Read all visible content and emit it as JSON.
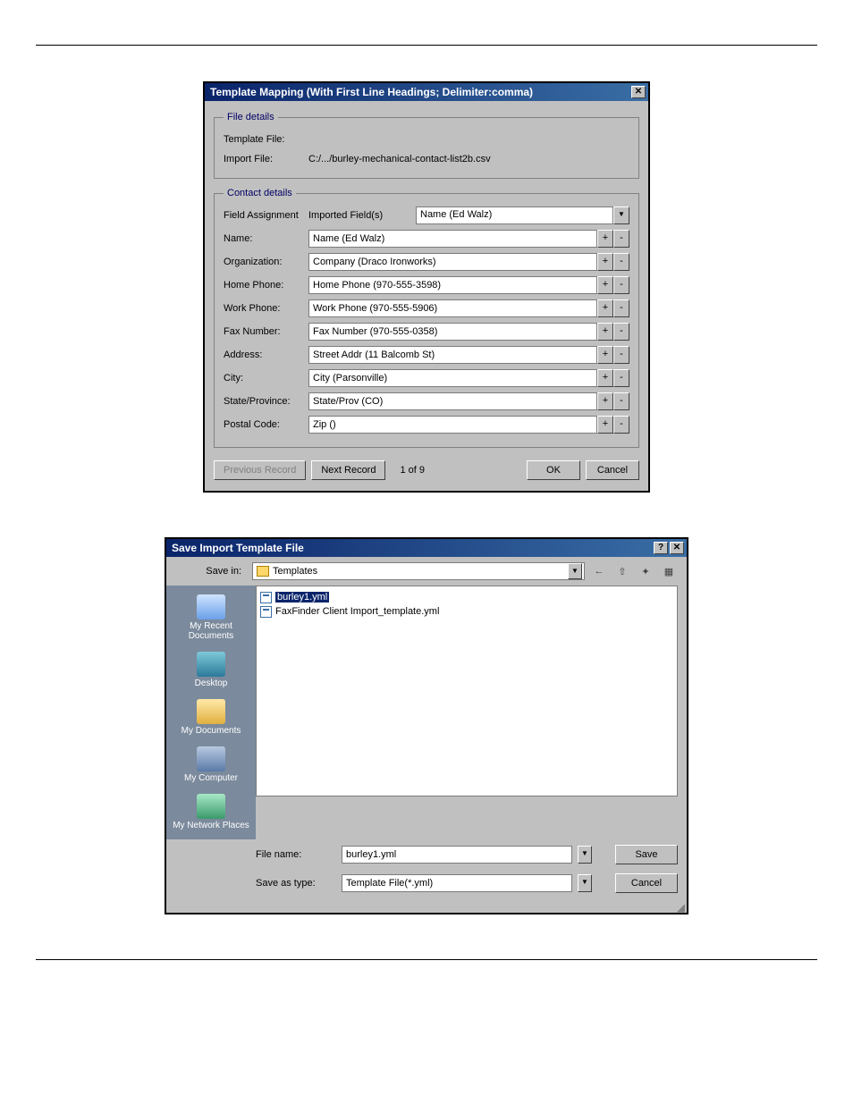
{
  "dialog1": {
    "title": "Template Mapping (With First Line Headings; Delimiter:comma)",
    "close_glyph": "✕",
    "file_details": {
      "legend": "File details",
      "template_label": "Template File:",
      "template_value": "",
      "import_label": "Import File:",
      "import_value": "C:/.../burley-mechanical-contact-list2b.csv"
    },
    "contact_details": {
      "legend": "Contact details",
      "field_assignment_label": "Field Assignment",
      "imported_fields_label": "Imported Field(s)",
      "imported_fields_value": "Name (Ed Walz)",
      "rows": [
        {
          "label": "Name:",
          "value": "Name (Ed Walz)"
        },
        {
          "label": "Organization:",
          "value": "Company (Draco Ironworks)"
        },
        {
          "label": "Home Phone:",
          "value": "Home Phone (970-555-3598)"
        },
        {
          "label": "Work Phone:",
          "value": "Work Phone (970-555-5906)"
        },
        {
          "label": "Fax Number:",
          "value": "Fax Number (970-555-0358)"
        },
        {
          "label": "Address:",
          "value": "Street Addr (11 Balcomb St)"
        },
        {
          "label": "City:",
          "value": "City (Parsonville)"
        },
        {
          "label": "State/Province:",
          "value": "State/Prov (CO)"
        },
        {
          "label": "Postal Code:",
          "value": "Zip ()"
        }
      ]
    },
    "footer": {
      "prev_label": "Previous Record",
      "next_label": "Next Record",
      "counter": "1 of 9",
      "ok_label": "OK",
      "cancel_label": "Cancel"
    },
    "plus_glyph": "+",
    "minus_glyph": "-",
    "dropdown_glyph": "▼"
  },
  "dialog2": {
    "title": "Save Import Template File",
    "help_glyph": "?",
    "close_glyph": "✕",
    "save_in_label": "Save in:",
    "save_in_value": "Templates",
    "dropdown_glyph": "▼",
    "toolbar": {
      "back": "←",
      "up": "⇧",
      "new": "✦",
      "views": "▦"
    },
    "places": [
      {
        "label": "My Recent Documents",
        "icon": "recent"
      },
      {
        "label": "Desktop",
        "icon": "desktop"
      },
      {
        "label": "My Documents",
        "icon": "docs"
      },
      {
        "label": "My Computer",
        "icon": "comp"
      },
      {
        "label": "My Network Places",
        "icon": "net"
      }
    ],
    "files": [
      {
        "name": "burley1.yml",
        "selected": true
      },
      {
        "name": "FaxFinder Client Import_template.yml",
        "selected": false
      }
    ],
    "filename_label": "File name:",
    "filename_value": "burley1.yml",
    "type_label": "Save as type:",
    "type_value": "Template File(*.yml)",
    "save_btn": "Save",
    "cancel_btn": "Cancel"
  }
}
